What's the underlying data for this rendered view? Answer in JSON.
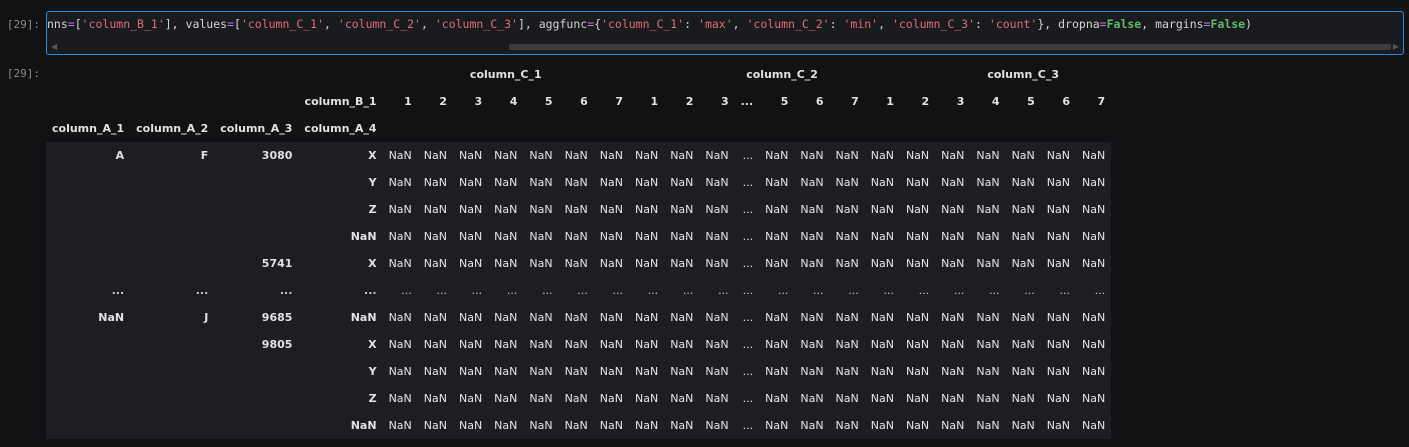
{
  "cell": {
    "in_prompt": "[29]:",
    "out_prompt": "[29]:",
    "code_segments": [
      {
        "t": "nns",
        "c": ""
      },
      {
        "t": "=",
        "c": "t-op"
      },
      {
        "t": "[",
        "c": ""
      },
      {
        "t": "'column_B_1'",
        "c": "t-str"
      },
      {
        "t": "], values",
        "c": ""
      },
      {
        "t": "=",
        "c": "t-op"
      },
      {
        "t": "[",
        "c": ""
      },
      {
        "t": "'column_C_1'",
        "c": "t-str"
      },
      {
        "t": ", ",
        "c": ""
      },
      {
        "t": "'column_C_2'",
        "c": "t-str"
      },
      {
        "t": ", ",
        "c": ""
      },
      {
        "t": "'column_C_3'",
        "c": "t-str"
      },
      {
        "t": "], aggfunc",
        "c": ""
      },
      {
        "t": "=",
        "c": "t-op"
      },
      {
        "t": "{",
        "c": ""
      },
      {
        "t": "'column_C_1'",
        "c": "t-str"
      },
      {
        "t": ": ",
        "c": ""
      },
      {
        "t": "'max'",
        "c": "t-str"
      },
      {
        "t": ", ",
        "c": ""
      },
      {
        "t": "'column_C_2'",
        "c": "t-str"
      },
      {
        "t": ": ",
        "c": ""
      },
      {
        "t": "'min'",
        "c": "t-str"
      },
      {
        "t": ", ",
        "c": ""
      },
      {
        "t": "'column_C_3'",
        "c": "t-str"
      },
      {
        "t": ": ",
        "c": ""
      },
      {
        "t": "'count'",
        "c": "t-str"
      },
      {
        "t": "}, dropna",
        "c": ""
      },
      {
        "t": "=",
        "c": "t-op"
      },
      {
        "t": "False",
        "c": "t-kw"
      },
      {
        "t": ", margins",
        "c": ""
      },
      {
        "t": "=",
        "c": "t-op"
      },
      {
        "t": "False",
        "c": "t-kw"
      },
      {
        "t": ")",
        "c": ""
      }
    ],
    "scroll_left_icon": "◀",
    "scroll_right_icon": "▶"
  },
  "table": {
    "header_top": [
      {
        "label": "",
        "span": 4
      },
      {
        "label": "column_C_1",
        "span": 7
      },
      {
        "label": "",
        "span": 3
      },
      {
        "label": "column_C_2",
        "span": 3
      },
      {
        "label": "",
        "span": 4
      },
      {
        "label": "column_C_3",
        "span": 3
      }
    ],
    "header_mid_label": "column_B_1",
    "header_mid": [
      "1",
      "2",
      "3",
      "4",
      "5",
      "6",
      "7",
      "1",
      "2",
      "3",
      "...",
      "5",
      "6",
      "7",
      "1",
      "2",
      "3",
      "4",
      "5",
      "6",
      "7"
    ],
    "index_names": [
      "column_A_1",
      "column_A_2",
      "column_A_3",
      "column_A_4"
    ],
    "rows": [
      {
        "idx": [
          "A",
          "F",
          "3080",
          "X"
        ]
      },
      {
        "idx": [
          "",
          "",
          "",
          "Y"
        ]
      },
      {
        "idx": [
          "",
          "",
          "",
          "Z"
        ]
      },
      {
        "idx": [
          "",
          "",
          "",
          "NaN"
        ]
      },
      {
        "idx": [
          "",
          "",
          "5741",
          "X"
        ]
      },
      {
        "idx": [
          "...",
          "...",
          "...",
          "..."
        ],
        "dots": true
      },
      {
        "idx": [
          "NaN",
          "J",
          "9685",
          "NaN"
        ]
      },
      {
        "idx": [
          "",
          "",
          "9805",
          "X"
        ]
      },
      {
        "idx": [
          "",
          "",
          "",
          "Y"
        ]
      },
      {
        "idx": [
          "",
          "",
          "",
          "Z"
        ]
      },
      {
        "idx": [
          "",
          "",
          "",
          "NaN"
        ]
      }
    ],
    "nan": "NaN",
    "ellipsis": "...",
    "ellipsis_col": 10,
    "n_value_cols": 21
  }
}
